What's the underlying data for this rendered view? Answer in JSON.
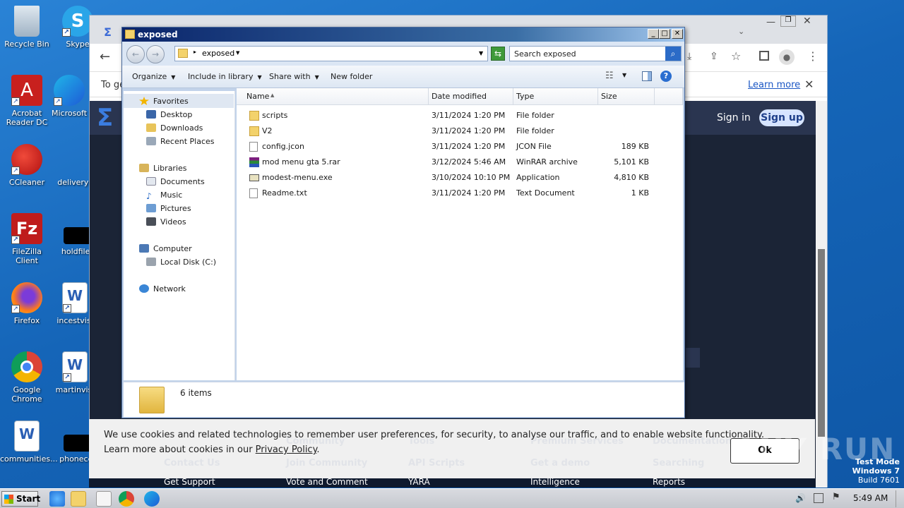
{
  "desktop": {
    "icons": [
      {
        "label": "Recycle Bin"
      },
      {
        "label": "Skype"
      },
      {
        "label": "Acrobat Reader DC"
      },
      {
        "label": "Microsoft"
      },
      {
        "label": "CCleaner"
      },
      {
        "label": "deliveryye"
      },
      {
        "label": "FileZilla Client"
      },
      {
        "label": "holdfiles"
      },
      {
        "label": "Firefox"
      },
      {
        "label": "incestvisi"
      },
      {
        "label": "Google Chrome"
      },
      {
        "label": "martinvisi"
      },
      {
        "label": "communities..."
      },
      {
        "label": "phonecer"
      }
    ]
  },
  "browser": {
    "infobar_text": "To ge",
    "learn_more": "Learn more",
    "sign_in": "Sign in",
    "sign_up": "Sign up"
  },
  "explorer": {
    "title": "exposed",
    "breadcrumb": "exposed",
    "search_placeholder": "Search exposed",
    "commands": {
      "organize": "Organize",
      "include": "Include in library",
      "share": "Share with",
      "new_folder": "New folder"
    },
    "nav": {
      "favorites": "Favorites",
      "desktop": "Desktop",
      "downloads": "Downloads",
      "recent": "Recent Places",
      "libraries": "Libraries",
      "documents": "Documents",
      "music": "Music",
      "pictures": "Pictures",
      "videos": "Videos",
      "computer": "Computer",
      "local_disk": "Local Disk (C:)",
      "network": "Network"
    },
    "columns": {
      "name": "Name",
      "date": "Date modified",
      "type": "Type",
      "size": "Size"
    },
    "files": [
      {
        "name": "scripts",
        "date": "3/11/2024 1:20 PM",
        "type": "File folder",
        "size": "",
        "icon": "folder-icon"
      },
      {
        "name": "V2",
        "date": "3/11/2024 1:20 PM",
        "type": "File folder",
        "size": "",
        "icon": "folder-icon"
      },
      {
        "name": "config.jcon",
        "date": "3/11/2024 1:20 PM",
        "type": "JCON File",
        "size": "189 KB",
        "icon": "file-icon"
      },
      {
        "name": "mod menu gta 5.rar",
        "date": "3/12/2024 5:46 AM",
        "type": "WinRAR archive",
        "size": "5,101 KB",
        "icon": "winrar-icon"
      },
      {
        "name": "modest-menu.exe",
        "date": "3/10/2024 10:10 PM",
        "type": "Application",
        "size": "4,810 KB",
        "icon": "exe-icon"
      },
      {
        "name": "Readme.txt",
        "date": "3/11/2024 1:20 PM",
        "type": "Text Document",
        "size": "1 KB",
        "icon": "text-file-icon"
      }
    ],
    "status": "6 items"
  },
  "cookie": {
    "line1": "We use cookies and related technologies to remember user preferences, for security, to analyse our traffic, and to enable website functionality.",
    "line2_prefix": "Learn more about cookies in our ",
    "privacy_link": "Privacy Policy",
    "line2_suffix": ".",
    "ok": "Ok"
  },
  "footer_links": [
    "Contact Us",
    "Join Community",
    "API Scripts",
    "Get a demo",
    "Searching",
    "Get Support",
    "Vote and Comment",
    "YARA",
    "Intelligence",
    "Reports",
    "Community",
    "Tools",
    "Premium Services",
    "Documentation"
  ],
  "watermark": {
    "brand": "ANY RUN",
    "mode": "Test Mode",
    "os": "Windows 7",
    "build": "Build 7601"
  },
  "taskbar": {
    "start": "Start",
    "clock": "5:49 AM"
  }
}
